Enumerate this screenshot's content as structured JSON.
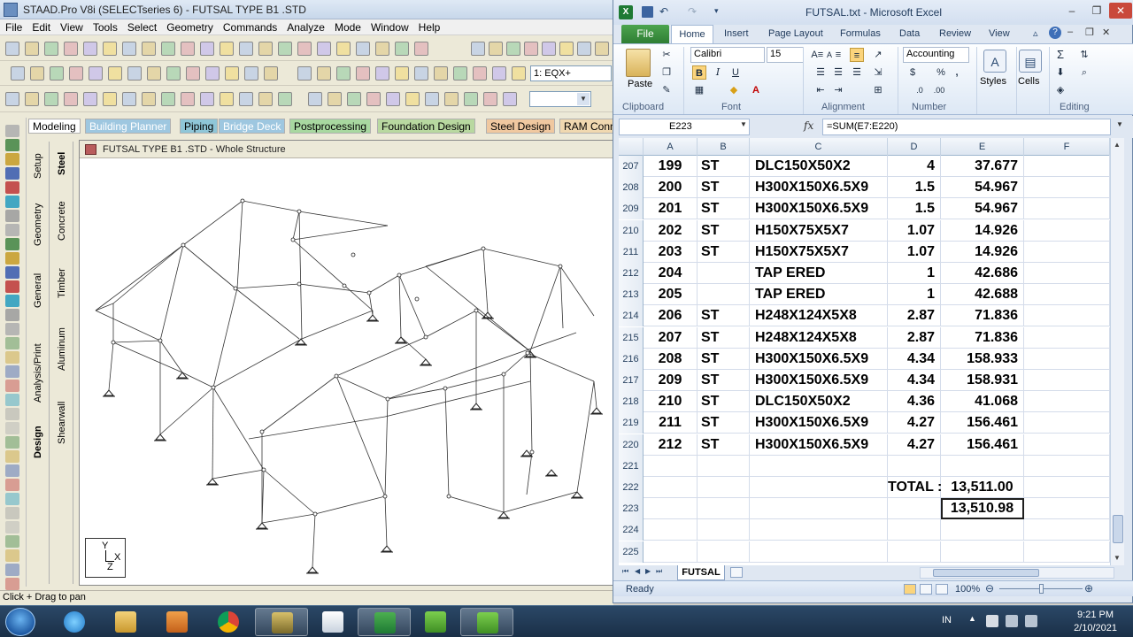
{
  "staad": {
    "title": "STAAD.Pro V8i (SELECTseries 6) - FUTSAL TYPE B1 .STD",
    "menu": [
      "File",
      "Edit",
      "View",
      "Tools",
      "Select",
      "Geometry",
      "Commands",
      "Analyze",
      "Mode",
      "Window",
      "Help"
    ],
    "load_combo": "1: EQX+",
    "mode_tabs": [
      "Modeling",
      "Building Planner",
      "Piping",
      "Bridge Deck",
      "Postprocessing",
      "Foundation Design",
      "Steel Design",
      "RAM Conn"
    ],
    "page_tabs_left": [
      "Setup",
      "Geometry",
      "General",
      "Analysis/Print",
      "Design"
    ],
    "page_tabs_right": [
      "Steel",
      "Concrete",
      "Timber",
      "Aluminum",
      "Shearwall"
    ],
    "view_title": "FUTSAL TYPE B1 .STD - Whole Structure",
    "axis_labels": {
      "y": "Y",
      "x": "X",
      "z": "Z"
    },
    "status": "Click + Drag to pan"
  },
  "excel": {
    "title": "FUTSAL.txt  -  Microsoft Excel",
    "file_tab": "File",
    "tabs": [
      "Home",
      "Insert",
      "Page Layout",
      "Formulas",
      "Data",
      "Review",
      "View"
    ],
    "font_name": "Calibri",
    "font_size": "15",
    "number_format": "Accounting",
    "groups": [
      "Clipboard",
      "Font",
      "Alignment",
      "Number",
      "Styles",
      "Cells",
      "Editing"
    ],
    "buttons": {
      "paste": "Paste",
      "styles": "Styles",
      "cells": "Cells",
      "bold": "B",
      "italic": "I",
      "underline": "U"
    },
    "name_box": "E223",
    "formula": "=SUM(E7:E220)",
    "columns": [
      "A",
      "B",
      "C",
      "D",
      "E",
      "F"
    ],
    "rows": [
      {
        "r": "207",
        "a": "199",
        "b": "ST",
        "c": "DLC150X50X2",
        "d": "4",
        "e": "37.677"
      },
      {
        "r": "208",
        "a": "200",
        "b": "ST",
        "c": "H300X150X6.5X9",
        "d": "1.5",
        "e": "54.967"
      },
      {
        "r": "209",
        "a": "201",
        "b": "ST",
        "c": "H300X150X6.5X9",
        "d": "1.5",
        "e": "54.967"
      },
      {
        "r": "210",
        "a": "202",
        "b": "ST",
        "c": "H150X75X5X7",
        "d": "1.07",
        "e": "14.926"
      },
      {
        "r": "211",
        "a": "203",
        "b": "ST",
        "c": "H150X75X5X7",
        "d": "1.07",
        "e": "14.926"
      },
      {
        "r": "212",
        "a": "204",
        "b": "",
        "c": "TAP ERED",
        "d": "1",
        "e": "42.686"
      },
      {
        "r": "213",
        "a": "205",
        "b": "",
        "c": "TAP ERED",
        "d": "1",
        "e": "42.688"
      },
      {
        "r": "214",
        "a": "206",
        "b": "ST",
        "c": "H248X124X5X8",
        "d": "2.87",
        "e": "71.836"
      },
      {
        "r": "215",
        "a": "207",
        "b": "ST",
        "c": "H248X124X5X8",
        "d": "2.87",
        "e": "71.836"
      },
      {
        "r": "216",
        "a": "208",
        "b": "ST",
        "c": "H300X150X6.5X9",
        "d": "4.34",
        "e": "158.933"
      },
      {
        "r": "217",
        "a": "209",
        "b": "ST",
        "c": "H300X150X6.5X9",
        "d": "4.34",
        "e": "158.931"
      },
      {
        "r": "218",
        "a": "210",
        "b": "ST",
        "c": "DLC150X50X2",
        "d": "4.36",
        "e": "41.068"
      },
      {
        "r": "219",
        "a": "211",
        "b": "ST",
        "c": "H300X150X6.5X9",
        "d": "4.27",
        "e": "156.461"
      },
      {
        "r": "220",
        "a": "212",
        "b": "ST",
        "c": "H300X150X6.5X9",
        "d": "4.27",
        "e": "156.461"
      },
      {
        "r": "221",
        "a": "",
        "b": "",
        "c": "",
        "d": "",
        "e": ""
      },
      {
        "r": "222",
        "a": "",
        "b": "",
        "c": "",
        "d": "TOTAL :",
        "e": "13,511.00"
      },
      {
        "r": "223",
        "a": "",
        "b": "",
        "c": "",
        "d": "",
        "e": "13,510.98"
      },
      {
        "r": "224",
        "a": "",
        "b": "",
        "c": "",
        "d": "",
        "e": ""
      },
      {
        "r": "225",
        "a": "",
        "b": "",
        "c": "",
        "d": "",
        "e": ""
      }
    ],
    "sheet_tab": "FUTSAL",
    "status": "Ready",
    "zoom": "100%"
  },
  "taskbar": {
    "ime": "IN",
    "time": "9:21 PM",
    "date": "2/10/2021"
  }
}
